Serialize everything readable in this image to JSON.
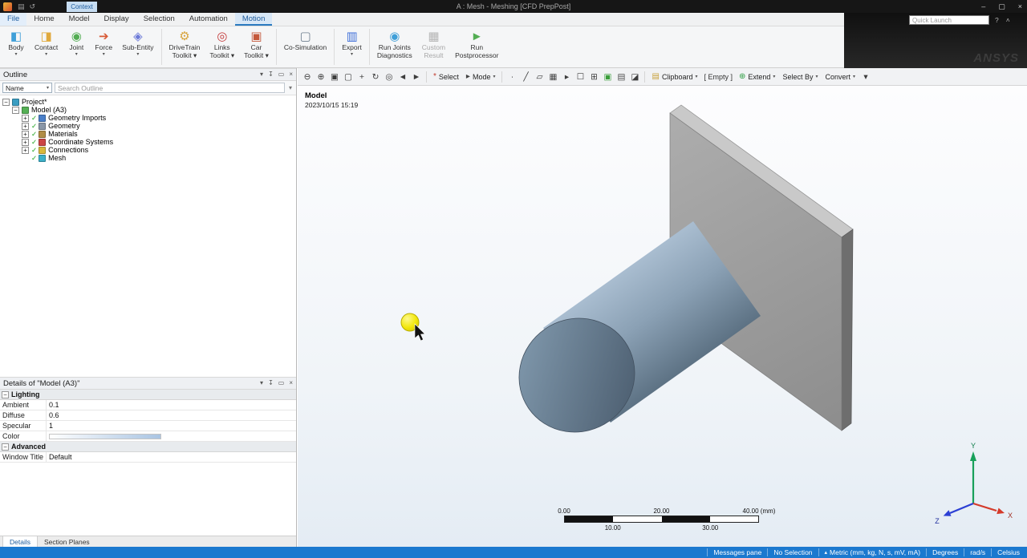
{
  "colors": {
    "statusbar": "#1b79cf",
    "accent": "#2a7ac0",
    "highlight": "#f2e70c",
    "plate": "#9b9b9b",
    "cylinder": "#879db2"
  },
  "titlebar": {
    "title": "A : Mesh - Meshing [CFD PrepPost]",
    "left_icons": [
      {
        "name": "save-icon",
        "glyph": "▤"
      },
      {
        "name": "undo-icon",
        "glyph": "↺"
      }
    ],
    "window_controls": [
      {
        "name": "minimize-icon",
        "glyph": "–"
      },
      {
        "name": "maximize-icon",
        "glyph": "▢"
      },
      {
        "name": "close-icon",
        "glyph": "×"
      }
    ]
  },
  "tabbar": {
    "context_label": "Context",
    "tabs": [
      {
        "label": "File",
        "file": true
      },
      {
        "label": "Home"
      },
      {
        "label": "Model"
      },
      {
        "label": "Display"
      },
      {
        "label": "Selection"
      },
      {
        "label": "Automation"
      },
      {
        "label": "Motion",
        "active": true
      }
    ],
    "quick_launch": {
      "placeholder": "Quick Launch"
    },
    "right_icons": [
      {
        "name": "help-icon",
        "glyph": "?"
      },
      {
        "name": "collapse-ribbon-icon",
        "glyph": "˄"
      }
    ]
  },
  "ribbon": {
    "brand": "ANSYS",
    "buttons": [
      {
        "line1": "Body",
        "glyph": "◧",
        "icon_color": "#3f9fd8",
        "caret": true
      },
      {
        "line1": "Contact",
        "glyph": "◨",
        "icon_color": "#e0a93c",
        "caret": true
      },
      {
        "line1": "Joint",
        "glyph": "◉",
        "icon_color": "#53ad53",
        "caret": true
      },
      {
        "line1": "Force",
        "glyph": "➔",
        "icon_color": "#d85a36",
        "caret": true
      },
      {
        "line1": "Sub-Entity",
        "glyph": "◈",
        "icon_color": "#6b79d8",
        "caret": true,
        "sep_after": true
      },
      {
        "line1": "DriveTrain",
        "line2": "Toolkit",
        "glyph": "⚙",
        "icon_color": "#d8a43c",
        "caret": true
      },
      {
        "line1": "Links",
        "line2": "Toolkit",
        "glyph": "◎",
        "icon_color": "#c43b3b",
        "caret": true
      },
      {
        "line1": "Car",
        "line2": "Toolkit",
        "glyph": "▣",
        "icon_color": "#c4583b",
        "caret": true,
        "sep_after": true
      },
      {
        "line1": "Co-Simulation",
        "glyph": "▢",
        "icon_color": "#6f7f8f",
        "sep_after": true
      },
      {
        "line1": "Export",
        "glyph": "▥",
        "icon_color": "#3f6fd8",
        "caret": true,
        "sep_after": true
      },
      {
        "line1": "Run Joints",
        "line2": "Diagnostics",
        "glyph": "◉",
        "icon_color": "#3f9fd8"
      },
      {
        "line1": "Custom",
        "line2": "Result",
        "glyph": "▦",
        "icon_color": "#9a9a9a",
        "disabled": true
      },
      {
        "line1": "Run",
        "line2": "Postprocessor",
        "glyph": "►",
        "icon_color": "#53ad53"
      }
    ]
  },
  "gfx_toolbar": {
    "items": [
      {
        "t": "icon",
        "name": "zoom-out-icon",
        "glyph": "⊖"
      },
      {
        "t": "icon",
        "name": "zoom-in-icon",
        "glyph": "⊕"
      },
      {
        "t": "icon",
        "name": "zoom-box-icon",
        "glyph": "▣"
      },
      {
        "t": "icon",
        "name": "zoom-fit-icon",
        "glyph": "▢"
      },
      {
        "t": "icon",
        "name": "pan-icon",
        "glyph": "+"
      },
      {
        "t": "icon",
        "name": "rotate-icon",
        "glyph": "↻"
      },
      {
        "t": "icon",
        "name": "look-at-icon",
        "glyph": "◎"
      },
      {
        "t": "icon",
        "name": "previous-view-icon",
        "glyph": "◄"
      },
      {
        "t": "icon",
        "name": "next-view-icon",
        "glyph": "►"
      },
      {
        "t": "sep"
      },
      {
        "t": "label",
        "name": "select-button",
        "icon_glyph": "*",
        "icon_color": "#c23b2e",
        "label": "Select"
      },
      {
        "t": "label",
        "name": "mode-dropdown",
        "icon_glyph": "▸",
        "icon_color": "#444444",
        "label": "Mode",
        "caret": true
      },
      {
        "t": "sep"
      },
      {
        "t": "icon",
        "name": "vertex-filter-icon",
        "glyph": "∙"
      },
      {
        "t": "icon",
        "name": "edge-filter-icon",
        "glyph": "╱"
      },
      {
        "t": "icon",
        "name": "face-filter-icon",
        "glyph": "▱"
      },
      {
        "t": "icon",
        "name": "body-filter-icon",
        "glyph": "▦"
      },
      {
        "t": "icon",
        "name": "pick-icon",
        "glyph": "▸"
      },
      {
        "t": "icon",
        "name": "box-select-icon",
        "glyph": "☐"
      },
      {
        "t": "icon",
        "name": "grow-selection-icon",
        "glyph": "⊞"
      },
      {
        "t": "icon",
        "name": "visibility-icon",
        "glyph": "▣",
        "color": "#3a9e3a"
      },
      {
        "t": "icon",
        "name": "wireframe-icon",
        "glyph": "▤"
      },
      {
        "t": "icon",
        "name": "section-plane-icon",
        "glyph": "◪"
      },
      {
        "t": "sep"
      },
      {
        "t": "label",
        "name": "clipboard-dropdown",
        "icon_glyph": "▤",
        "icon_color": "#c8a23c",
        "label": "Clipboard",
        "caret": true
      },
      {
        "t": "badge",
        "name": "clipboard-empty-badge",
        "label": "[ Empty ]"
      },
      {
        "t": "label",
        "name": "extend-dropdown",
        "icon_glyph": "⊕",
        "icon_color": "#2f9e44",
        "label": "Extend",
        "caret": true
      },
      {
        "t": "label",
        "name": "select-by-dropdown",
        "label": "Select By",
        "caret": true
      },
      {
        "t": "label",
        "name": "convert-dropdown",
        "label": "Convert",
        "caret": true
      },
      {
        "t": "icon",
        "name": "more-options-icon",
        "glyph": "▾"
      }
    ]
  },
  "outline": {
    "title": "Outline",
    "header_icons": [
      {
        "name": "dropdown-icon",
        "glyph": "▾"
      },
      {
        "name": "pin-icon",
        "glyph": "↧"
      },
      {
        "name": "float-icon",
        "glyph": "▭"
      },
      {
        "name": "close-icon",
        "glyph": "×"
      }
    ],
    "filter": {
      "name_label": "Name",
      "search_placeholder": "Search Outline"
    },
    "tree": [
      {
        "label": "Project*",
        "level": 0,
        "expander": "minus",
        "icon": "project-icon",
        "icon_color": "#3b9ec2"
      },
      {
        "label": "Model (A3)",
        "level": 1,
        "expander": "minus",
        "icon": "model-icon",
        "icon_color": "#55b055"
      },
      {
        "label": "Geometry Imports",
        "level": 2,
        "expander": "plus",
        "check": true,
        "icon": "geometry-imports-icon",
        "icon_color": "#4a7fc9"
      },
      {
        "label": "Geometry",
        "level": 2,
        "expander": "plus",
        "check": true,
        "icon": "geometry-icon",
        "icon_color": "#8a97a8"
      },
      {
        "label": "Materials",
        "level": 2,
        "expander": "plus",
        "check": true,
        "icon": "materials-icon",
        "icon_color": "#b08d45"
      },
      {
        "label": "Coordinate Systems",
        "level": 2,
        "expander": "plus",
        "check": true,
        "icon": "coordinate-systems-icon",
        "icon_color": "#cc4444"
      },
      {
        "label": "Connections",
        "level": 2,
        "expander": "plus",
        "check": true,
        "icon": "connections-icon",
        "icon_color": "#d8b83c"
      },
      {
        "label": "Mesh",
        "level": 2,
        "expander": "none",
        "check": true,
        "icon": "mesh-icon",
        "icon_color": "#3bb0c9"
      }
    ]
  },
  "details": {
    "title": "Details of \"Model (A3)\"",
    "header_icons": [
      {
        "name": "dropdown-icon",
        "glyph": "▾"
      },
      {
        "name": "pin-icon",
        "glyph": "↧"
      },
      {
        "name": "float-icon",
        "glyph": "▭"
      },
      {
        "name": "close-icon",
        "glyph": "×"
      }
    ],
    "sections": [
      {
        "header": "Lighting",
        "rows": [
          {
            "label": "Ambient",
            "value": "0.1"
          },
          {
            "label": "Diffuse",
            "value": "0.6"
          },
          {
            "label": "Specular",
            "value": "1"
          },
          {
            "label": "Color",
            "value": "",
            "swatch": true
          }
        ]
      },
      {
        "header": "Advanced",
        "rows": [
          {
            "label": "Window Title",
            "value": "Default"
          }
        ]
      }
    ],
    "bottom_tabs": [
      "Details",
      "Section Planes"
    ]
  },
  "viewport": {
    "annotation": {
      "title": "Model",
      "timestamp": "2023/10/15 15:19"
    },
    "ruler": {
      "top_labels": [
        "0.00",
        "20.00",
        "40.00 (mm)"
      ],
      "bottom_labels": [
        "10.00",
        "30.00"
      ],
      "segments": [
        "#111111",
        "#ffffff",
        "#111111",
        "#ffffff"
      ]
    },
    "triad": {
      "x_label": "X",
      "y_label": "Y",
      "z_label": "Z",
      "x_color": "#d43a2a",
      "y_color": "#18a05a",
      "z_color": "#2b3fd4"
    }
  },
  "statusbar": {
    "items": [
      {
        "label": "Messages pane"
      },
      {
        "label": "No Selection"
      },
      {
        "label": "Metric (mm, kg, N, s, mV, mA)",
        "icon": "▴"
      },
      {
        "label": "Degrees"
      },
      {
        "label": "rad/s"
      },
      {
        "label": "Celsius"
      }
    ]
  }
}
